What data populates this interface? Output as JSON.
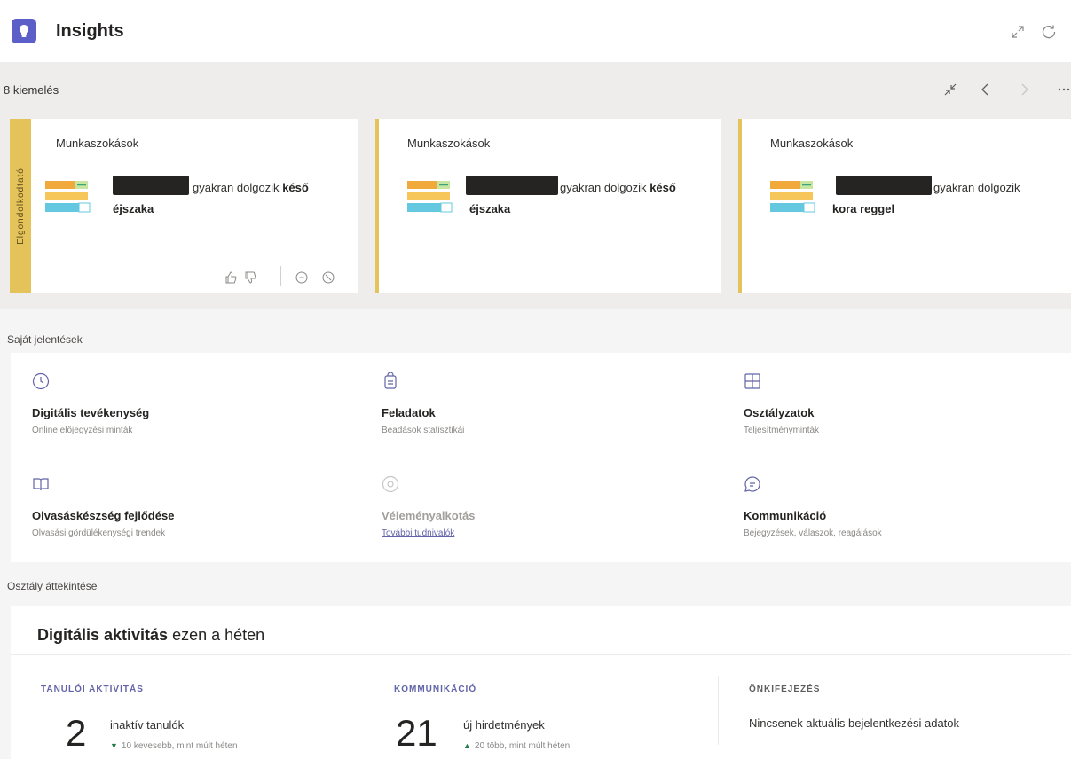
{
  "header": {
    "title": "Insights",
    "accent_color": "#5b5fc7",
    "expand_icon": "expand-icon",
    "refresh_icon": "refresh-icon"
  },
  "highlights": {
    "count_label": "8 kiemelés",
    "collapse_icon": "collapse-icon",
    "prev_icon": "chevron-left-icon",
    "next_icon": "chevron-right-icon",
    "more_icon": "more-icon",
    "accent_color": "#e4c35a",
    "cards": [
      {
        "side_label": "Elgondolkodtató",
        "title": "Munkaszokások",
        "text": "gyakran dolgozik",
        "bold_text": "késő",
        "line2_bold": "éjszaka"
      },
      {
        "title": "Munkaszokások",
        "text": "gyakran dolgozik",
        "bold_text": "késő",
        "line2_bold": "éjszaka"
      },
      {
        "title": "Munkaszokások",
        "text": "gyakran dolgozik",
        "bold_text": "",
        "line2_bold": "kora reggel"
      }
    ]
  },
  "reports_section": {
    "heading": "Saját jelentések",
    "items": [
      {
        "name": "Digitális tevékenység",
        "desc": "Online előjegyzési minták",
        "icon": "clock-icon"
      },
      {
        "name": "Feladatok",
        "desc": "Beadások statisztikái",
        "icon": "clipboard-icon"
      },
      {
        "name": "Osztályzatok",
        "desc": "Teljesítményminták",
        "icon": "grid-icon"
      },
      {
        "name": "Olvasáskészség fejlődése",
        "desc": "Olvasási gördülékenységi trendek",
        "icon": "book-icon"
      },
      {
        "name": "Véleményalkotás",
        "desc": "További tudnivalók",
        "icon": "reflect-icon"
      },
      {
        "name": "Kommunikáció",
        "desc": "Bejegyzések, válaszok, reagálások",
        "icon": "chat-icon"
      }
    ]
  },
  "overview": {
    "heading": "Osztály áttekintése",
    "title_bold": "Digitális aktivitás",
    "title_rest": "ezen a héten",
    "columns": [
      {
        "caption": "TANULÓI AKTIVITÁS",
        "number": "2",
        "label": "inaktív tanulók",
        "delta": "10 kevesebb, mint múlt héten",
        "arrow": "▼"
      },
      {
        "caption": "KOMMUNIKÁCIÓ",
        "number": "21",
        "label": "új hirdetmények",
        "delta": "20 több, mint múlt héten",
        "arrow": "▲"
      },
      {
        "caption": "ÖNKIFEJEZÉS",
        "nodata": "Nincsenek aktuális bejelentkezési adatok"
      }
    ]
  }
}
